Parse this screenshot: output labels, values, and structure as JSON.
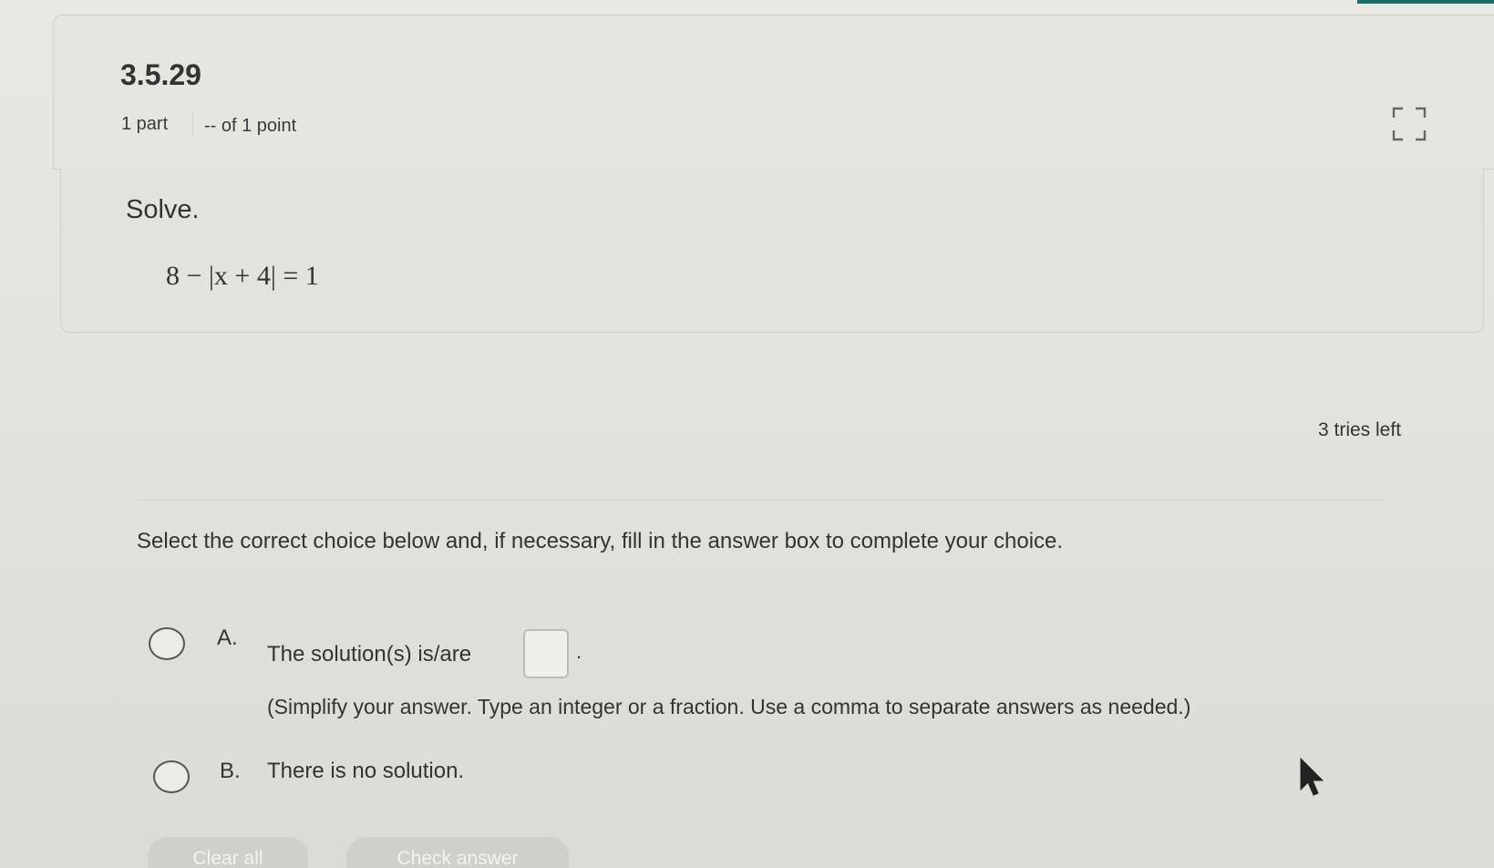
{
  "question": {
    "number": "3.5.29",
    "parts": "1 part",
    "points": "-- of 1 point"
  },
  "problem": {
    "instruction": "Solve.",
    "equation": "8 − |x + 4| = 1"
  },
  "status": {
    "tries_left": "3 tries left"
  },
  "prompt": "Select the correct choice below and, if necessary, fill in the answer box to complete your choice.",
  "choices": [
    {
      "letter": "A.",
      "text": "The solution(s) is/are",
      "period": ".",
      "hint": "(Simplify your answer. Type an integer or a fraction. Use a comma to separate answers as needed.)",
      "selected": false
    },
    {
      "letter": "B.",
      "text": "There is no solution.",
      "selected": false
    }
  ],
  "buttons": {
    "clear_all": "Clear all",
    "check_answer": "Check answer"
  },
  "icons": {
    "expand": "expand-icon",
    "cursor": "mouse-pointer-icon"
  },
  "colors": {
    "accent": "#1c6b66",
    "button_disabled": "#cfcfcc"
  }
}
